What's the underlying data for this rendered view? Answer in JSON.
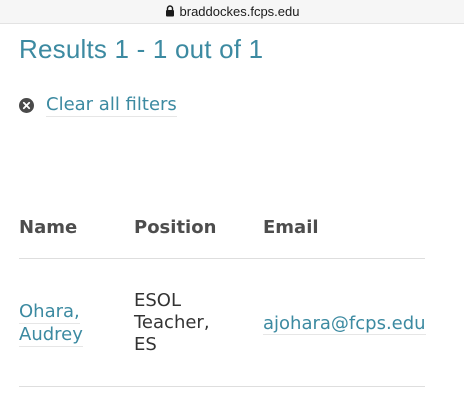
{
  "browser": {
    "url": "braddockes.fcps.edu"
  },
  "results": {
    "summary": "Results 1 - 1 out of 1",
    "clear_filters_label": "Clear all filters"
  },
  "table": {
    "headers": [
      "Name",
      "Position",
      "Email"
    ],
    "rows": [
      {
        "name_last": "Ohara,",
        "name_first": "Audrey",
        "position": [
          "ESOL",
          "Teacher,",
          "ES"
        ],
        "email": "ajohara@fcps.edu"
      }
    ]
  },
  "colors": {
    "accent": "#3c8aa1",
    "header_text": "#4d4d4d",
    "body_text": "#333333"
  }
}
